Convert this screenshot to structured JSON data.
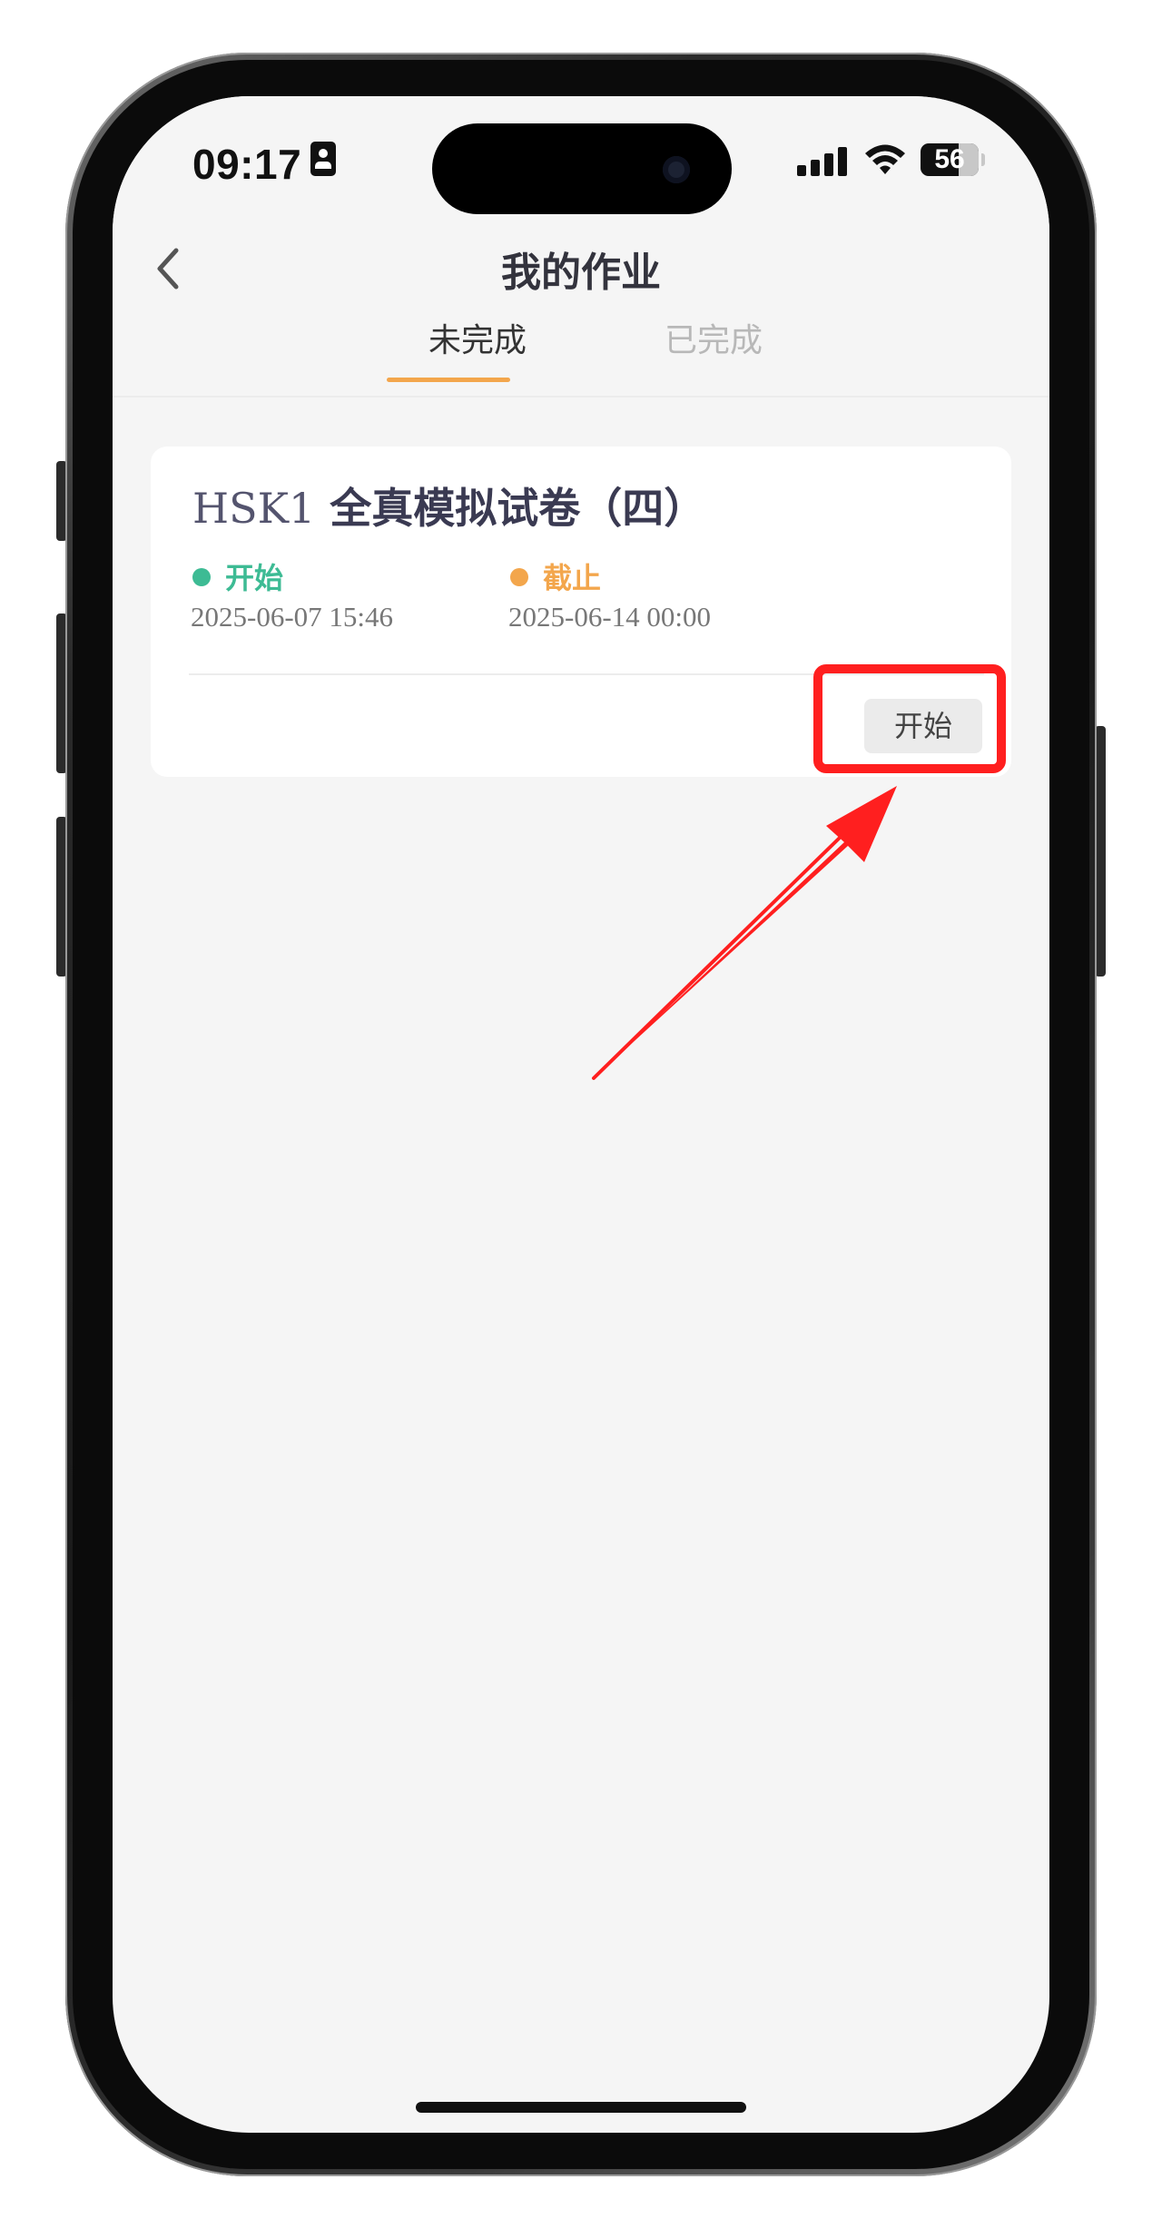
{
  "status_bar": {
    "time": "09:17",
    "battery": "56"
  },
  "header": {
    "title": "我的作业"
  },
  "tabs": [
    {
      "label": "未完成",
      "active": true
    },
    {
      "label": "已完成",
      "active": false
    }
  ],
  "assignments": [
    {
      "title_prefix": "HSK1",
      "title": "全真模拟试卷（四）",
      "start_label": "开始",
      "start_date": "2025-06-07 15:46",
      "deadline_label": "截止",
      "deadline_date": "2025-06-14 00:00",
      "action_label": "开始"
    }
  ],
  "colors": {
    "accent": "#f3a64c",
    "start_green": "#3dbb94",
    "deadline_orange": "#f3a64c",
    "annotation_red": "#ff1f1f"
  }
}
